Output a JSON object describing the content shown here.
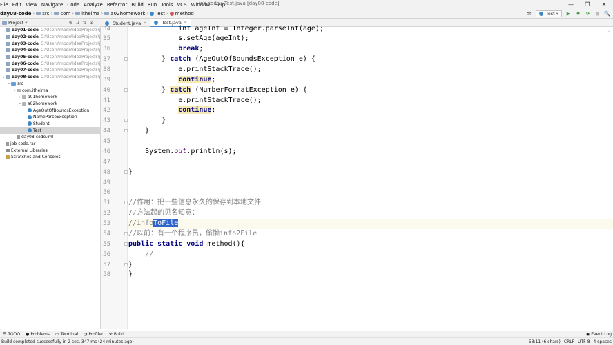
{
  "menu": [
    "File",
    "Edit",
    "View",
    "Navigate",
    "Code",
    "Analyze",
    "Refactor",
    "Build",
    "Run",
    "Tools",
    "VCS",
    "Window",
    "Help"
  ],
  "window_title": "job-code - Test.java [day08-code]",
  "window_controls": [
    "—",
    "❐",
    "✕"
  ],
  "breadcrumbs": [
    "day08-code",
    "src",
    "com",
    "itheima",
    "a02homework",
    "Test",
    "method"
  ],
  "toolbar": {
    "run_config": "Test",
    "buttons": [
      "⬇",
      "▶",
      "✹",
      "⟳",
      "◼",
      "🔍"
    ]
  },
  "project_panel": {
    "title": "Project",
    "items": [
      {
        "name": "day01-code",
        "path": "C:\\Users\\moon\\IdeaProjects\\job-c",
        "indent": 0,
        "arrow": "›",
        "icon": "mod",
        "bold": true
      },
      {
        "name": "day02-code",
        "path": "C:\\Users\\moon\\IdeaProjects\\job-c",
        "indent": 0,
        "arrow": "›",
        "icon": "mod",
        "bold": true
      },
      {
        "name": "day03-code",
        "path": "C:\\Users\\moon\\IdeaProjects\\job-c",
        "indent": 0,
        "arrow": "›",
        "icon": "mod",
        "bold": true
      },
      {
        "name": "day04-code",
        "path": "C:\\Users\\moon\\IdeaProjects\\job-c",
        "indent": 0,
        "arrow": "›",
        "icon": "mod",
        "bold": true
      },
      {
        "name": "day05-code",
        "path": "C:\\Users\\moon\\IdeaProjects\\job-c",
        "indent": 0,
        "arrow": "›",
        "icon": "mod",
        "bold": true
      },
      {
        "name": "day06-code",
        "path": "C:\\Users\\moon\\IdeaProjects\\job-c",
        "indent": 0,
        "arrow": "›",
        "icon": "mod",
        "bold": true
      },
      {
        "name": "day07-code",
        "path": "C:\\Users\\moon\\IdeaProjects\\job-c",
        "indent": 0,
        "arrow": "›",
        "icon": "mod",
        "bold": true
      },
      {
        "name": "day08-code",
        "path": "C:\\Users\\moon\\IdeaProjects\\job-c",
        "indent": 0,
        "arrow": "⌄",
        "icon": "mod",
        "bold": true
      },
      {
        "name": "src",
        "path": "",
        "indent": 1,
        "arrow": "⌄",
        "icon": "src",
        "bold": false
      },
      {
        "name": "com.itheima",
        "path": "",
        "indent": 2,
        "arrow": "⌄",
        "icon": "pkg",
        "bold": false
      },
      {
        "name": "a01homework",
        "path": "",
        "indent": 3,
        "arrow": "›",
        "icon": "pkg",
        "bold": false
      },
      {
        "name": "a02homework",
        "path": "",
        "indent": 3,
        "arrow": "⌄",
        "icon": "pkg",
        "bold": false
      },
      {
        "name": "AgeOutOfBoundsException",
        "path": "",
        "indent": 4,
        "arrow": "",
        "icon": "cls",
        "bold": false
      },
      {
        "name": "NameParseException",
        "path": "",
        "indent": 4,
        "arrow": "",
        "icon": "cls",
        "bold": false
      },
      {
        "name": "Student",
        "path": "",
        "indent": 4,
        "arrow": "",
        "icon": "cls",
        "bold": false
      },
      {
        "name": "Test",
        "path": "",
        "indent": 4,
        "arrow": "",
        "icon": "cls",
        "bold": false,
        "selected": true
      },
      {
        "name": "day08-code.iml",
        "path": "",
        "indent": 2,
        "arrow": "",
        "icon": "file",
        "bold": false
      },
      {
        "name": "job-code.rar",
        "path": "",
        "indent": 0,
        "arrow": "",
        "icon": "file",
        "bold": false
      },
      {
        "name": "External Libraries",
        "path": "",
        "indent": 0,
        "arrow": "›",
        "icon": "lib",
        "bold": false
      },
      {
        "name": "Scratches and Consoles",
        "path": "",
        "indent": 0,
        "arrow": "›",
        "icon": "scratch",
        "bold": false
      }
    ]
  },
  "editor_tabs": [
    {
      "label": "Student.java",
      "active": false
    },
    {
      "label": "Test.java",
      "active": true
    }
  ],
  "editor": {
    "current_line": 53,
    "first_line": 34,
    "lines": [
      {
        "n": 34,
        "html": "            <span>int ageInt = Integer.parseInt(age);</span>"
      },
      {
        "n": 35,
        "html": "            s.setAge(ageInt);"
      },
      {
        "n": 36,
        "html": "            <span class=\"kw\">break</span>;"
      },
      {
        "n": 37,
        "html": "        } <span class=\"kw\">catch</span> (AgeOutOfBoundsException e) {"
      },
      {
        "n": 38,
        "html": "            e.printStackTrace();"
      },
      {
        "n": 39,
        "html": "            <span class=\"kwhl\">continue</span>;"
      },
      {
        "n": 40,
        "html": "        } <span class=\"kwhl\">catch</span> (NumberFormatException e) {"
      },
      {
        "n": 41,
        "html": "            e.printStackTrace();"
      },
      {
        "n": 42,
        "html": "            <span class=\"kwhl\">continue</span>;"
      },
      {
        "n": 43,
        "html": "        }"
      },
      {
        "n": 44,
        "html": "    }"
      },
      {
        "n": 45,
        "html": ""
      },
      {
        "n": 46,
        "html": "    System.<span class=\"ital\">out</span>.println(s);"
      },
      {
        "n": 47,
        "html": ""
      },
      {
        "n": 48,
        "html": "}"
      },
      {
        "n": 49,
        "html": ""
      },
      {
        "n": 50,
        "html": ""
      },
      {
        "n": 51,
        "html": "<span class=\"comment\">//作用：把一些信息永久的保存到本地文件</span>"
      },
      {
        "n": 52,
        "html": "<span class=\"comment\">//方法起的见名知意：</span>"
      },
      {
        "n": 53,
        "html": "<span class=\"comment\">//info<span class=\"sel\">ToFile</span></span>"
      },
      {
        "n": 54,
        "html": "<span class=\"comment\">//以前：有一个程序员，偷懒info2File</span>"
      },
      {
        "n": 55,
        "html": "<span class=\"kw\">public static void</span> method(){"
      },
      {
        "n": 56,
        "html": "    <span class=\"comment\">//</span>"
      },
      {
        "n": 57,
        "html": "}"
      },
      {
        "n": 58,
        "html": "}"
      }
    ]
  },
  "bottom_tools": [
    {
      "icon": "☰",
      "label": "TODO"
    },
    {
      "icon": "●",
      "label": "Problems"
    },
    {
      "icon": "▭",
      "label": "Terminal"
    },
    {
      "icon": "◔",
      "label": "Profiler"
    },
    {
      "icon": "⚒",
      "label": "Build"
    }
  ],
  "event_log": "Event Log",
  "status": {
    "message": "Build completed successfully in 2 sec, 347 ms (24 minutes ago)",
    "position": "53:11 (6 chars)",
    "line_sep": "CRLF",
    "encoding": "UTF-8",
    "indent": "4 spaces"
  },
  "colors": {
    "accent": "#4a88c7",
    "selection": "#2f65ca",
    "keyword": "#000080",
    "comment": "#808080"
  }
}
